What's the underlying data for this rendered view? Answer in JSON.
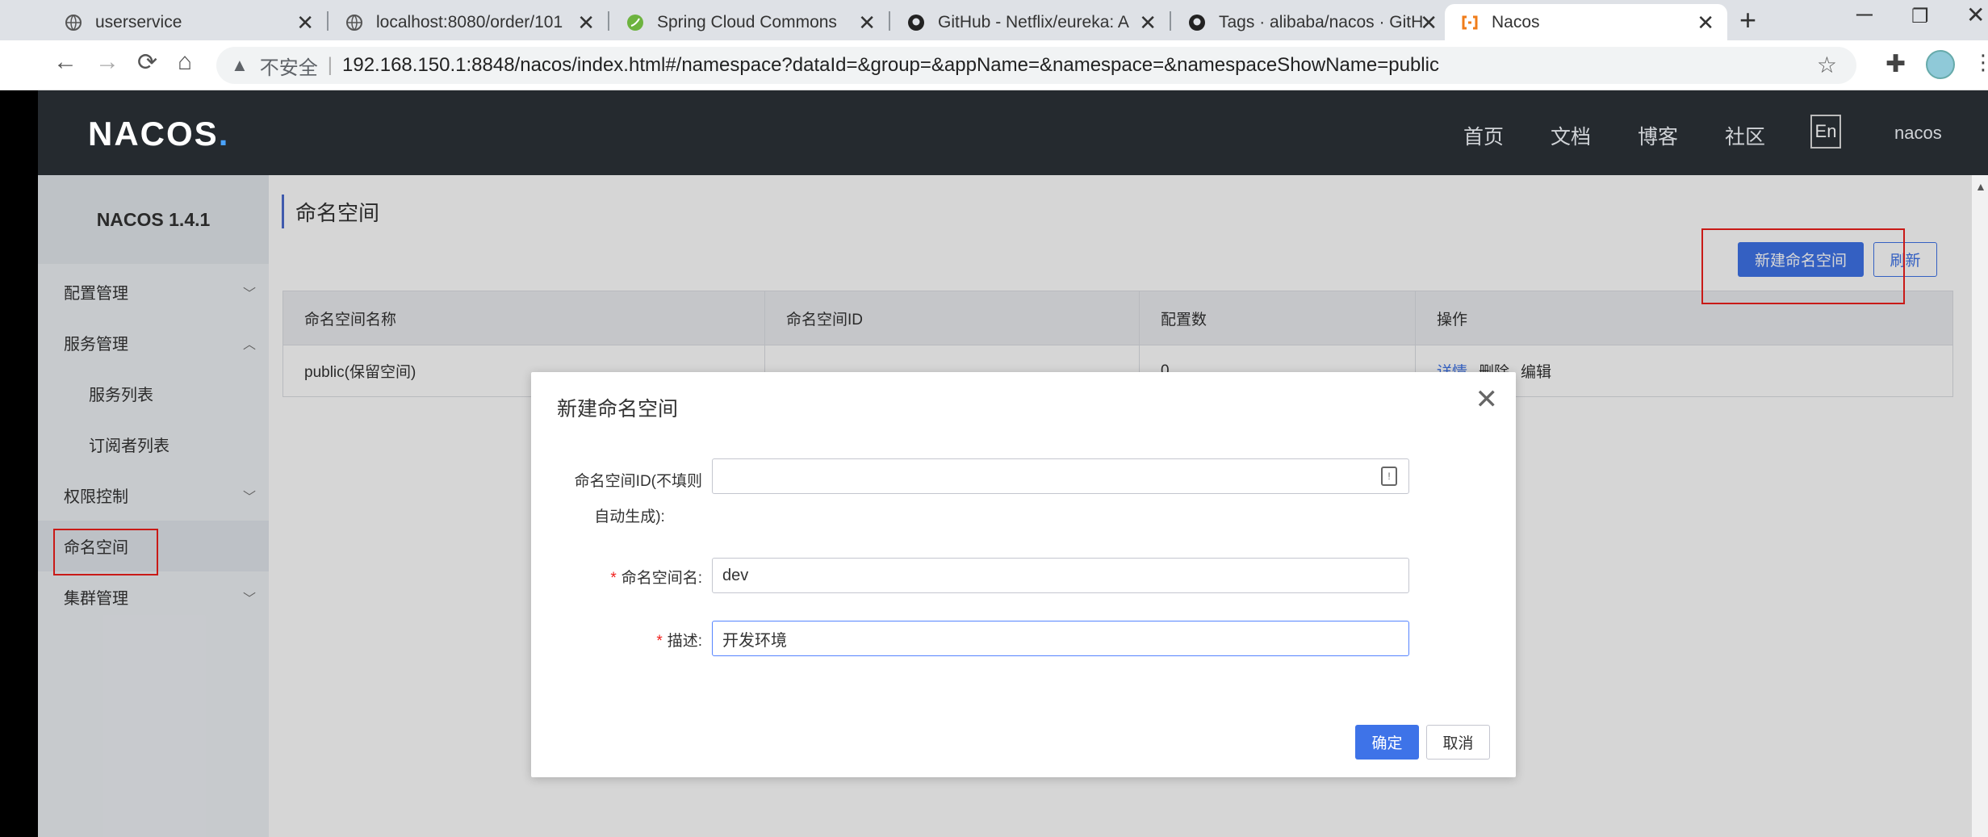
{
  "browser": {
    "tabs": [
      {
        "title": "userservice",
        "favicon": "globe-icon",
        "active": false
      },
      {
        "title": "localhost:8080/order/101",
        "favicon": "globe-icon",
        "active": false
      },
      {
        "title": "Spring Cloud Commons",
        "favicon": "spring-leaf-icon",
        "active": false
      },
      {
        "title": "GitHub - Netflix/eureka: A",
        "favicon": "github-icon",
        "active": false
      },
      {
        "title": "Tags · alibaba/nacos · GitH",
        "favicon": "github-icon",
        "active": false
      },
      {
        "title": "Nacos",
        "favicon": "nacos-icon",
        "active": true
      }
    ],
    "tab_close_glyph": "✕",
    "new_tab_glyph": "+",
    "address": {
      "security_label": "不安全",
      "separator": "|",
      "url": "192.168.150.1:8848/nacos/index.html#/namespace?dataId=&group=&appName=&namespace=&namespaceShowName=public"
    }
  },
  "header": {
    "logo": "NACOS",
    "logo_dot": ".",
    "nav": [
      "首页",
      "文档",
      "博客",
      "社区"
    ],
    "lang": "En",
    "user": "nacos"
  },
  "sidebar": {
    "version": "NACOS 1.4.1",
    "items": [
      {
        "label": "配置管理",
        "chevron": "down"
      },
      {
        "label": "服务管理",
        "chevron": "up"
      },
      {
        "label": "服务列表",
        "chevron": ""
      },
      {
        "label": "订阅者列表",
        "chevron": ""
      },
      {
        "label": "权限控制",
        "chevron": "down"
      },
      {
        "label": "命名空间",
        "chevron": ""
      },
      {
        "label": "集群管理",
        "chevron": "down"
      }
    ]
  },
  "page": {
    "title": "命名空间",
    "new_button": "新建命名空间",
    "refresh_button": "刷新",
    "table": {
      "columns": [
        "命名空间名称",
        "命名空间ID",
        "配置数",
        "操作"
      ],
      "rows": [
        {
          "name": "public(保留空间)",
          "id": "",
          "count": "0",
          "actions": [
            "详情",
            "删除",
            "编辑"
          ]
        }
      ]
    }
  },
  "dialog": {
    "title": "新建命名空间",
    "fields": [
      {
        "label_line1": "命名空间ID(不填则",
        "label_line2": "自动生成):",
        "required": false,
        "value": ""
      },
      {
        "label": "命名空间名:",
        "required": true,
        "value": "dev"
      },
      {
        "label": "描述:",
        "required": true,
        "value": "开发环境"
      }
    ],
    "required_mark": "*",
    "ok": "确定",
    "cancel": "取消"
  },
  "colors": {
    "header_bg": "#252a2f",
    "primary": "#3e73e8",
    "annotation_red": "#f0201c"
  }
}
